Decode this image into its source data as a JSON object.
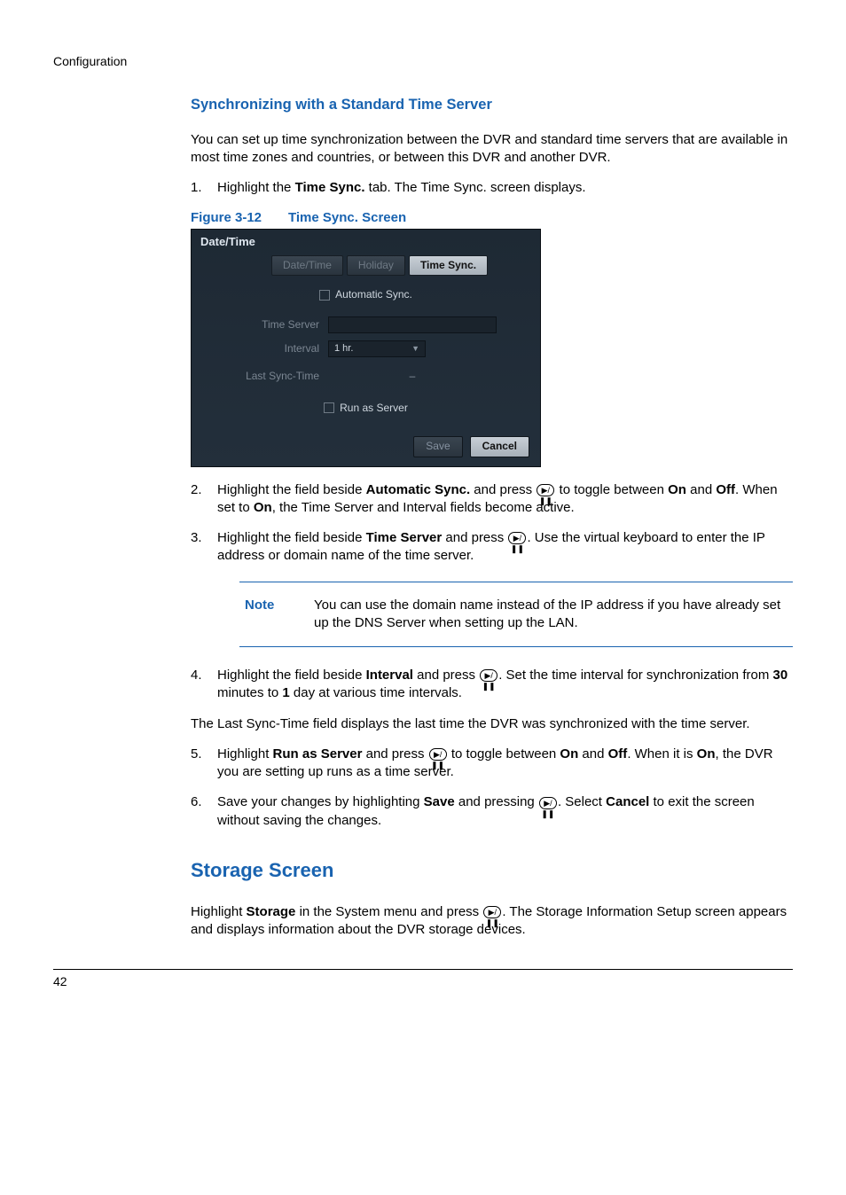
{
  "header": {
    "section": "Configuration"
  },
  "subsection": {
    "title": "Synchronizing with a Standard Time Server"
  },
  "intro": "You can set up time synchronization between the DVR and standard time servers that are available in most time zones and countries, or between this DVR and another DVR.",
  "step1": {
    "num": "1.",
    "a": "Highlight the ",
    "b": "Time Sync.",
    "c": " tab. The Time Sync. screen displays."
  },
  "figure": {
    "ref": "Figure 3-12",
    "title": "Time Sync. Screen"
  },
  "dialog": {
    "title": "Date/Time",
    "tabs": {
      "t1": "Date/Time",
      "t2": "Holiday",
      "t3": "Time Sync."
    },
    "auto_sync_label": "Automatic Sync.",
    "time_server_label": "Time Server",
    "interval_label": "Interval",
    "interval_value": "1 hr.",
    "last_sync_label": "Last Sync-Time",
    "last_sync_value": "–",
    "run_as_server_label": "Run as Server",
    "save": "Save",
    "cancel": "Cancel"
  },
  "step2": {
    "num": "2.",
    "a": "Highlight the field beside ",
    "b": "Automatic Sync.",
    "c": " and press ",
    "d": " to toggle between ",
    "e": "On",
    "f": " and ",
    "g": "Off",
    "h": ". When set to ",
    "i": "On",
    "j": ", the Time Server and Interval fields become active."
  },
  "step3": {
    "num": "3.",
    "a": "Highlight the field beside ",
    "b": "Time Server",
    "c": " and press ",
    "d": ". Use the virtual keyboard to enter the IP address or domain name of the time server."
  },
  "note": {
    "label": "Note",
    "text": "You can use the domain name instead of the IP address if you have already set up the DNS Server when setting up the LAN."
  },
  "step4": {
    "num": "4.",
    "a": "Highlight the field beside ",
    "b": "Interval",
    "c": " and press ",
    "d": ". Set the time interval for synchronization from ",
    "e": "30",
    "f": " minutes to ",
    "g": "1",
    "h": " day at various time intervals."
  },
  "mid_para": "The Last Sync-Time field displays the last time the DVR was synchronized with the time server.",
  "step5": {
    "num": "5.",
    "a": "Highlight ",
    "b": "Run as Server",
    "c": " and press ",
    "d": " to toggle between ",
    "e": "On",
    "f": " and ",
    "g": "Off",
    "h": ". When it is ",
    "i": "On",
    "j": ", the DVR you are setting up runs as a time server."
  },
  "step6": {
    "num": "6.",
    "a": "Save your changes by highlighting ",
    "b": "Save",
    "c": " and pressing ",
    "d": ". Select ",
    "e": "Cancel",
    "f": " to exit the screen without saving the changes."
  },
  "section2": {
    "title": "Storage Screen",
    "a": "Highlight ",
    "b": "Storage",
    "c": " in the System menu and press ",
    "d": ". The Storage Information Setup screen appears and displays information about the DVR storage devices."
  },
  "page": "42",
  "icon_glyph": "▶/❚❚"
}
